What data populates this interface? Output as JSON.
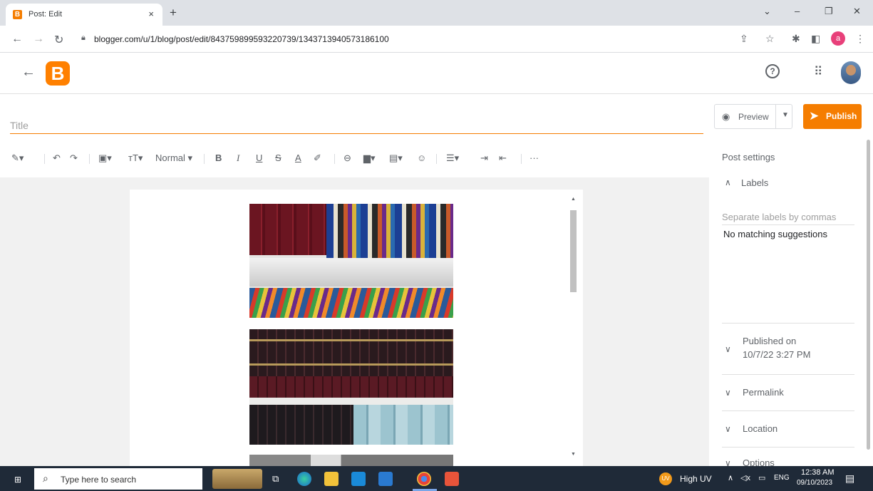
{
  "browser": {
    "tab_title": "Post: Edit",
    "tab_close": "×",
    "new_tab": "+",
    "url": "blogger.com/u/1/blog/post/edit/843759899593220739/1343713940573186100",
    "profile_letter": "a"
  },
  "window_controls": {
    "chevron": "⌄",
    "minimize": "–",
    "restore": "❐",
    "close": "✕"
  },
  "header": {
    "help": "?"
  },
  "editor": {
    "title_placeholder": "Title",
    "preview_label": "Preview",
    "publish_label": "Publish",
    "toolbar": {
      "paragraph_style": "Normal",
      "bold": "B",
      "italic": "I",
      "underline": "U",
      "strike": "S",
      "text_color": "A",
      "more": "···"
    }
  },
  "post_settings": {
    "heading": "Post settings",
    "labels_section": "Labels",
    "labels_placeholder": "Separate labels by commas",
    "no_suggestions": "No matching suggestions",
    "published_on_label": "Published on",
    "published_on_value": "10/7/22 3:27 PM",
    "permalink": "Permalink",
    "location": "Location",
    "options": "Options"
  },
  "taskbar": {
    "search_placeholder": "Type here to search",
    "weather": "High UV",
    "weather_badge": "UV",
    "language": "ENG",
    "time": "12:38 AM",
    "date": "09/10/2023"
  },
  "colors": {
    "accent": "#f57d00",
    "taskbar": "#1f2a38"
  }
}
